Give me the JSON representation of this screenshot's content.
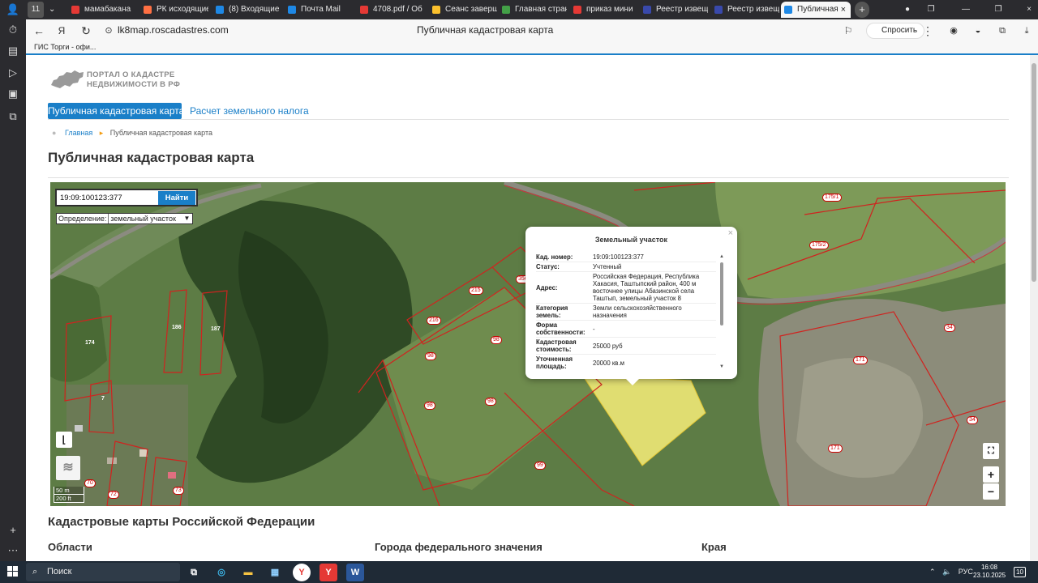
{
  "browser": {
    "tabs": [
      {
        "label": "мамабакана",
        "color": "#e53935"
      },
      {
        "label": "РК исходящие",
        "color": "#ff7043"
      },
      {
        "label": "(8) Входящие",
        "color": "#1e88e5"
      },
      {
        "label": "Почта Mail",
        "color": "#1e88e5"
      },
      {
        "label": "4708.pdf / Об",
        "color": "#e53935"
      },
      {
        "label": "Сеанс заверш",
        "color": "#fbc02d"
      },
      {
        "label": "Главная стран",
        "color": "#43a047"
      },
      {
        "label": "приказ мини",
        "color": "#e53935"
      },
      {
        "label": "Реестр извещ",
        "color": "#3949ab"
      },
      {
        "label": "Реестр извещ",
        "color": "#3949ab"
      },
      {
        "label": "Публичная",
        "color": "#1e88e5"
      }
    ],
    "tab_count_badge": "11",
    "url": "lk8map.roscadastres.com",
    "page_title": "Публичная кадастровая карта",
    "ask_label": "Спросить",
    "bookmark": "ГИС Торги - офи..."
  },
  "site": {
    "logo_line1": "ПОРТАЛ О КАДАСТРЕ",
    "logo_line2": "НЕДВИЖИМОСТИ В РФ",
    "nav_active": "Публичная кадастровая карта",
    "nav_second": "Расчет земельного налога",
    "breadcrumb_home": "Главная",
    "breadcrumb_current": "Публичная кадастровая карта",
    "page_heading": "Публичная кадастровая карта"
  },
  "map": {
    "search_value": "19:09:100123:377",
    "search_button": "Найти",
    "definition_label": "Определение:",
    "definition_value": "земельный участок",
    "scale_m": "50 m",
    "scale_ft": "200 ft",
    "zoom_in": "+",
    "zoom_out": "−",
    "parcel_labels": {
      "p174": "174",
      "p186": "186",
      "p187": "187",
      "p7": "7",
      "p215": "215",
      "p216": "216",
      "p356": "356",
      "p98a": "98",
      "p98b": "98",
      "p98c": "98",
      "p98d": "98",
      "p99": "99",
      "p171a": "171",
      "p171b": "171",
      "p34a": "34",
      "p34b": "34",
      "p1751": "175/1",
      "p1752": "175/2",
      "p70": "70",
      "p72": "72",
      "p73": "73"
    }
  },
  "popup": {
    "title": "Земельный участок",
    "rows": [
      {
        "key": "Кад. номер:",
        "value": "19:09:100123:377"
      },
      {
        "key": "Статус:",
        "value": "Учтенный"
      },
      {
        "key": "Адрес:",
        "value": "Российская Федерация, Республика Хакасия, Таштыпский район, 400 м восточнее улицы Абазинской села Таштып, земельный участок 8"
      },
      {
        "key": "Категория земель:",
        "value": "Земли сельскохозяйственного назначения"
      },
      {
        "key": "Форма собственности:",
        "value": "-"
      },
      {
        "key": "Кадастровая стоимость:",
        "value": "25000 руб"
      },
      {
        "key": "Уточненная площадь:",
        "value": "20000 кв.м"
      }
    ]
  },
  "below": {
    "section_title": "Кадастровые карты Российской Федерации",
    "col1": "Области",
    "col2": "Города федерального значения",
    "col3": "Края"
  },
  "taskbar": {
    "search_label": "Поиск",
    "lang": "РУС",
    "time": "16:08",
    "date": "23.10.2025",
    "notif": "10"
  }
}
